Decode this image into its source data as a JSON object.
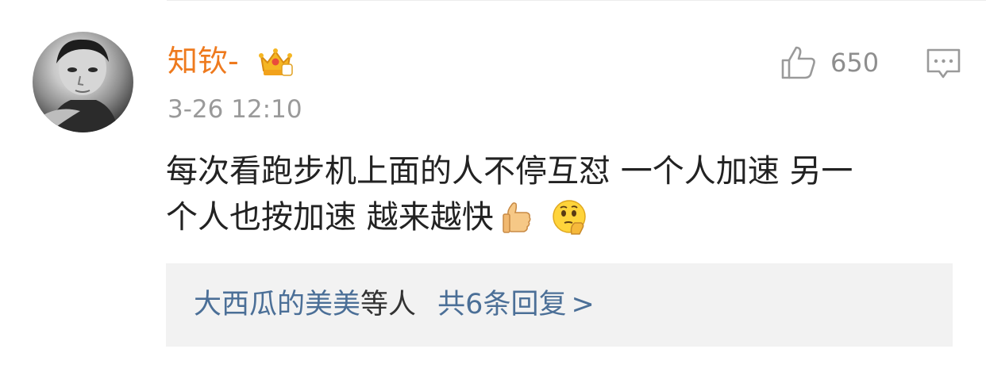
{
  "comment": {
    "username": "知钦-",
    "timestamp": "3-26 12:10",
    "likes": "650",
    "text_line1": "每次看跑步机上面的人不停互怼 一个人加速 另一",
    "text_line2": "个人也按加速 越来越快",
    "emojis": [
      "thumbs-up-icon",
      "thinking-face-icon"
    ]
  },
  "replies": {
    "names": "大西瓜的美美",
    "middle": "等人",
    "count_text": "共6条回复",
    "chevron": ">"
  },
  "colors": {
    "username": "#ee7a1e",
    "link": "#4b6f97",
    "meta": "#9a9a9a",
    "reply_bg": "#f2f2f2"
  }
}
